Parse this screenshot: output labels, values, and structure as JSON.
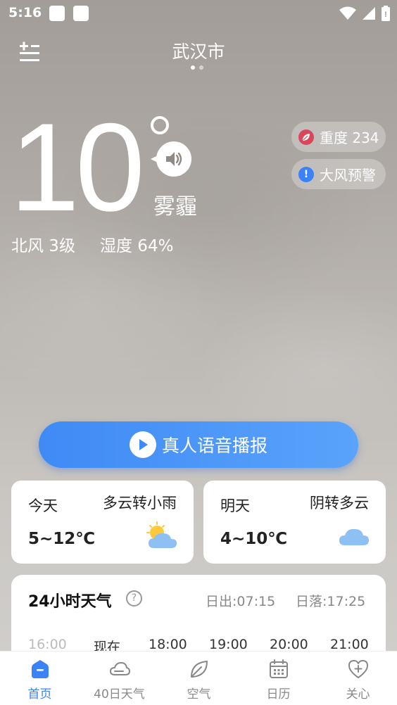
{
  "status_bar": {
    "time": "5:16"
  },
  "header": {
    "city": "武汉市"
  },
  "current": {
    "temperature": "10",
    "condition": "雾霾",
    "wind": "北风 3级",
    "humidity": "湿度 64%"
  },
  "badges": {
    "air_quality": "重度 234",
    "warning": "大风预警",
    "warning_icon_glyph": "!"
  },
  "voice_button": {
    "label": "真人语音播报"
  },
  "forecast": [
    {
      "day": "今天",
      "condition": "多云转小雨",
      "range": "5~12℃",
      "icon": "partly-cloudy-icon"
    },
    {
      "day": "明天",
      "condition": "阴转多云",
      "range": "4~10℃",
      "icon": "cloudy-icon"
    }
  ],
  "hourly": {
    "title": "24小时天气",
    "help_glyph": "?",
    "sunrise": "日出:07:15",
    "sunset": "日落:17:25",
    "hours": [
      "16:00",
      "现在",
      "18:00",
      "19:00",
      "20:00",
      "21:00"
    ]
  },
  "nav": {
    "items": [
      {
        "label": "首页",
        "icon": "home-icon",
        "active": true
      },
      {
        "label": "40日天气",
        "icon": "cloud-icon",
        "active": false
      },
      {
        "label": "空气",
        "icon": "leaf-icon",
        "active": false
      },
      {
        "label": "日历",
        "icon": "calendar-icon",
        "active": false
      },
      {
        "label": "关心",
        "icon": "heart-plus-icon",
        "active": false
      }
    ]
  },
  "colors": {
    "accent": "#3b82f6",
    "air_quality_icon": "#d9475a",
    "warning_icon": "#3b82f6"
  }
}
